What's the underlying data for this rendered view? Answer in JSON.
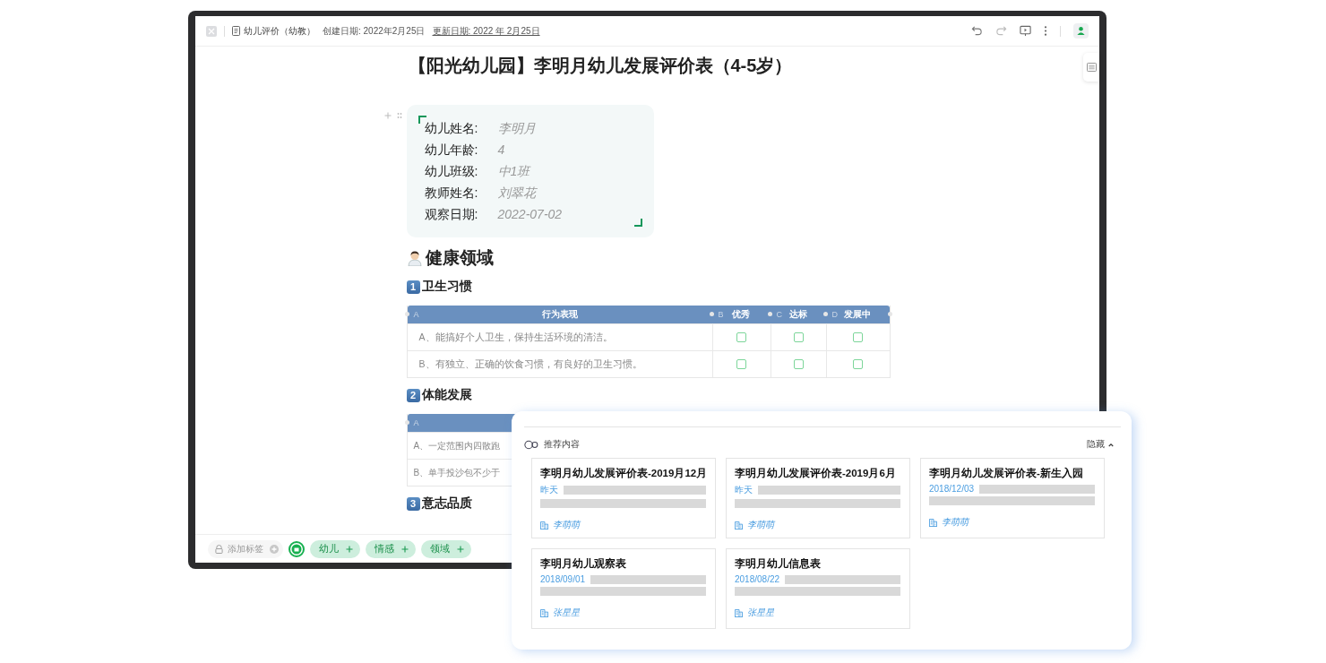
{
  "toolbar": {
    "doc_title": "幼儿评价（幼教）",
    "created": "创建日期: 2022年2月25日",
    "updated": "更新日期: 2022 年 2月25日"
  },
  "document": {
    "title": "【阳光幼儿园】李明月幼儿发展评价表（4-5岁）",
    "info": [
      {
        "label": "幼儿姓名:",
        "value": "李明月"
      },
      {
        "label": "幼儿年龄:",
        "value": "4"
      },
      {
        "label": "幼儿班级:",
        "value": "中1班"
      },
      {
        "label": "教师姓名:",
        "value": "刘翠花"
      },
      {
        "label": "观察日期:",
        "value": "2022-07-02"
      }
    ],
    "section": {
      "heading": "健康领域",
      "subsections": [
        {
          "number": "1",
          "heading": "卫生习惯",
          "table": {
            "columns": [
              {
                "letter": "A",
                "title": "行为表现"
              },
              {
                "letter": "B",
                "title": "优秀"
              },
              {
                "letter": "C",
                "title": "达标"
              },
              {
                "letter": "D",
                "title": "发展中"
              }
            ],
            "rows": [
              {
                "text": "A、能搞好个人卫生，保持生活环境的清洁。",
                "checks": [
                  {
                    "checked": false
                  },
                  {
                    "checked": false
                  },
                  {
                    "checked": false
                  }
                ]
              },
              {
                "text": "B、有独立、正确的饮食习惯，有良好的卫生习惯。",
                "checks": [
                  {
                    "checked": false
                  },
                  {
                    "checked": false
                  },
                  {
                    "checked": false
                  }
                ]
              }
            ]
          }
        },
        {
          "number": "2",
          "heading": "体能发展",
          "table": {
            "columns": [
              {
                "letter": "A"
              }
            ],
            "rows": [
              {
                "text": "A、一定范围内四散跑"
              },
              {
                "text": "B、单手投沙包不少于"
              }
            ]
          }
        },
        {
          "number": "3",
          "heading": "意志品质"
        }
      ]
    }
  },
  "tag_bar": {
    "placeholder": "添加标签",
    "tags": [
      "幼儿",
      "情感",
      "领域"
    ]
  },
  "recommendations": {
    "title": "推荐内容",
    "hide_label": "隐藏",
    "cards": [
      {
        "title": "李明月幼儿发展评价表-2019月12月",
        "date": "昨天",
        "author": "李萌萌"
      },
      {
        "title": "李明月幼儿发展评价表-2019月6月",
        "date": "昨天",
        "author": "李萌萌"
      },
      {
        "title": "李明月幼儿发展评价表-新生入园",
        "date": "2018/12/03",
        "author": "李萌萌"
      },
      {
        "title": "李明月幼儿观察表",
        "date": "2018/09/01",
        "author": "张星星"
      },
      {
        "title": "李明月幼儿信息表",
        "date": "2018/08/22",
        "author": "张星星"
      }
    ]
  }
}
